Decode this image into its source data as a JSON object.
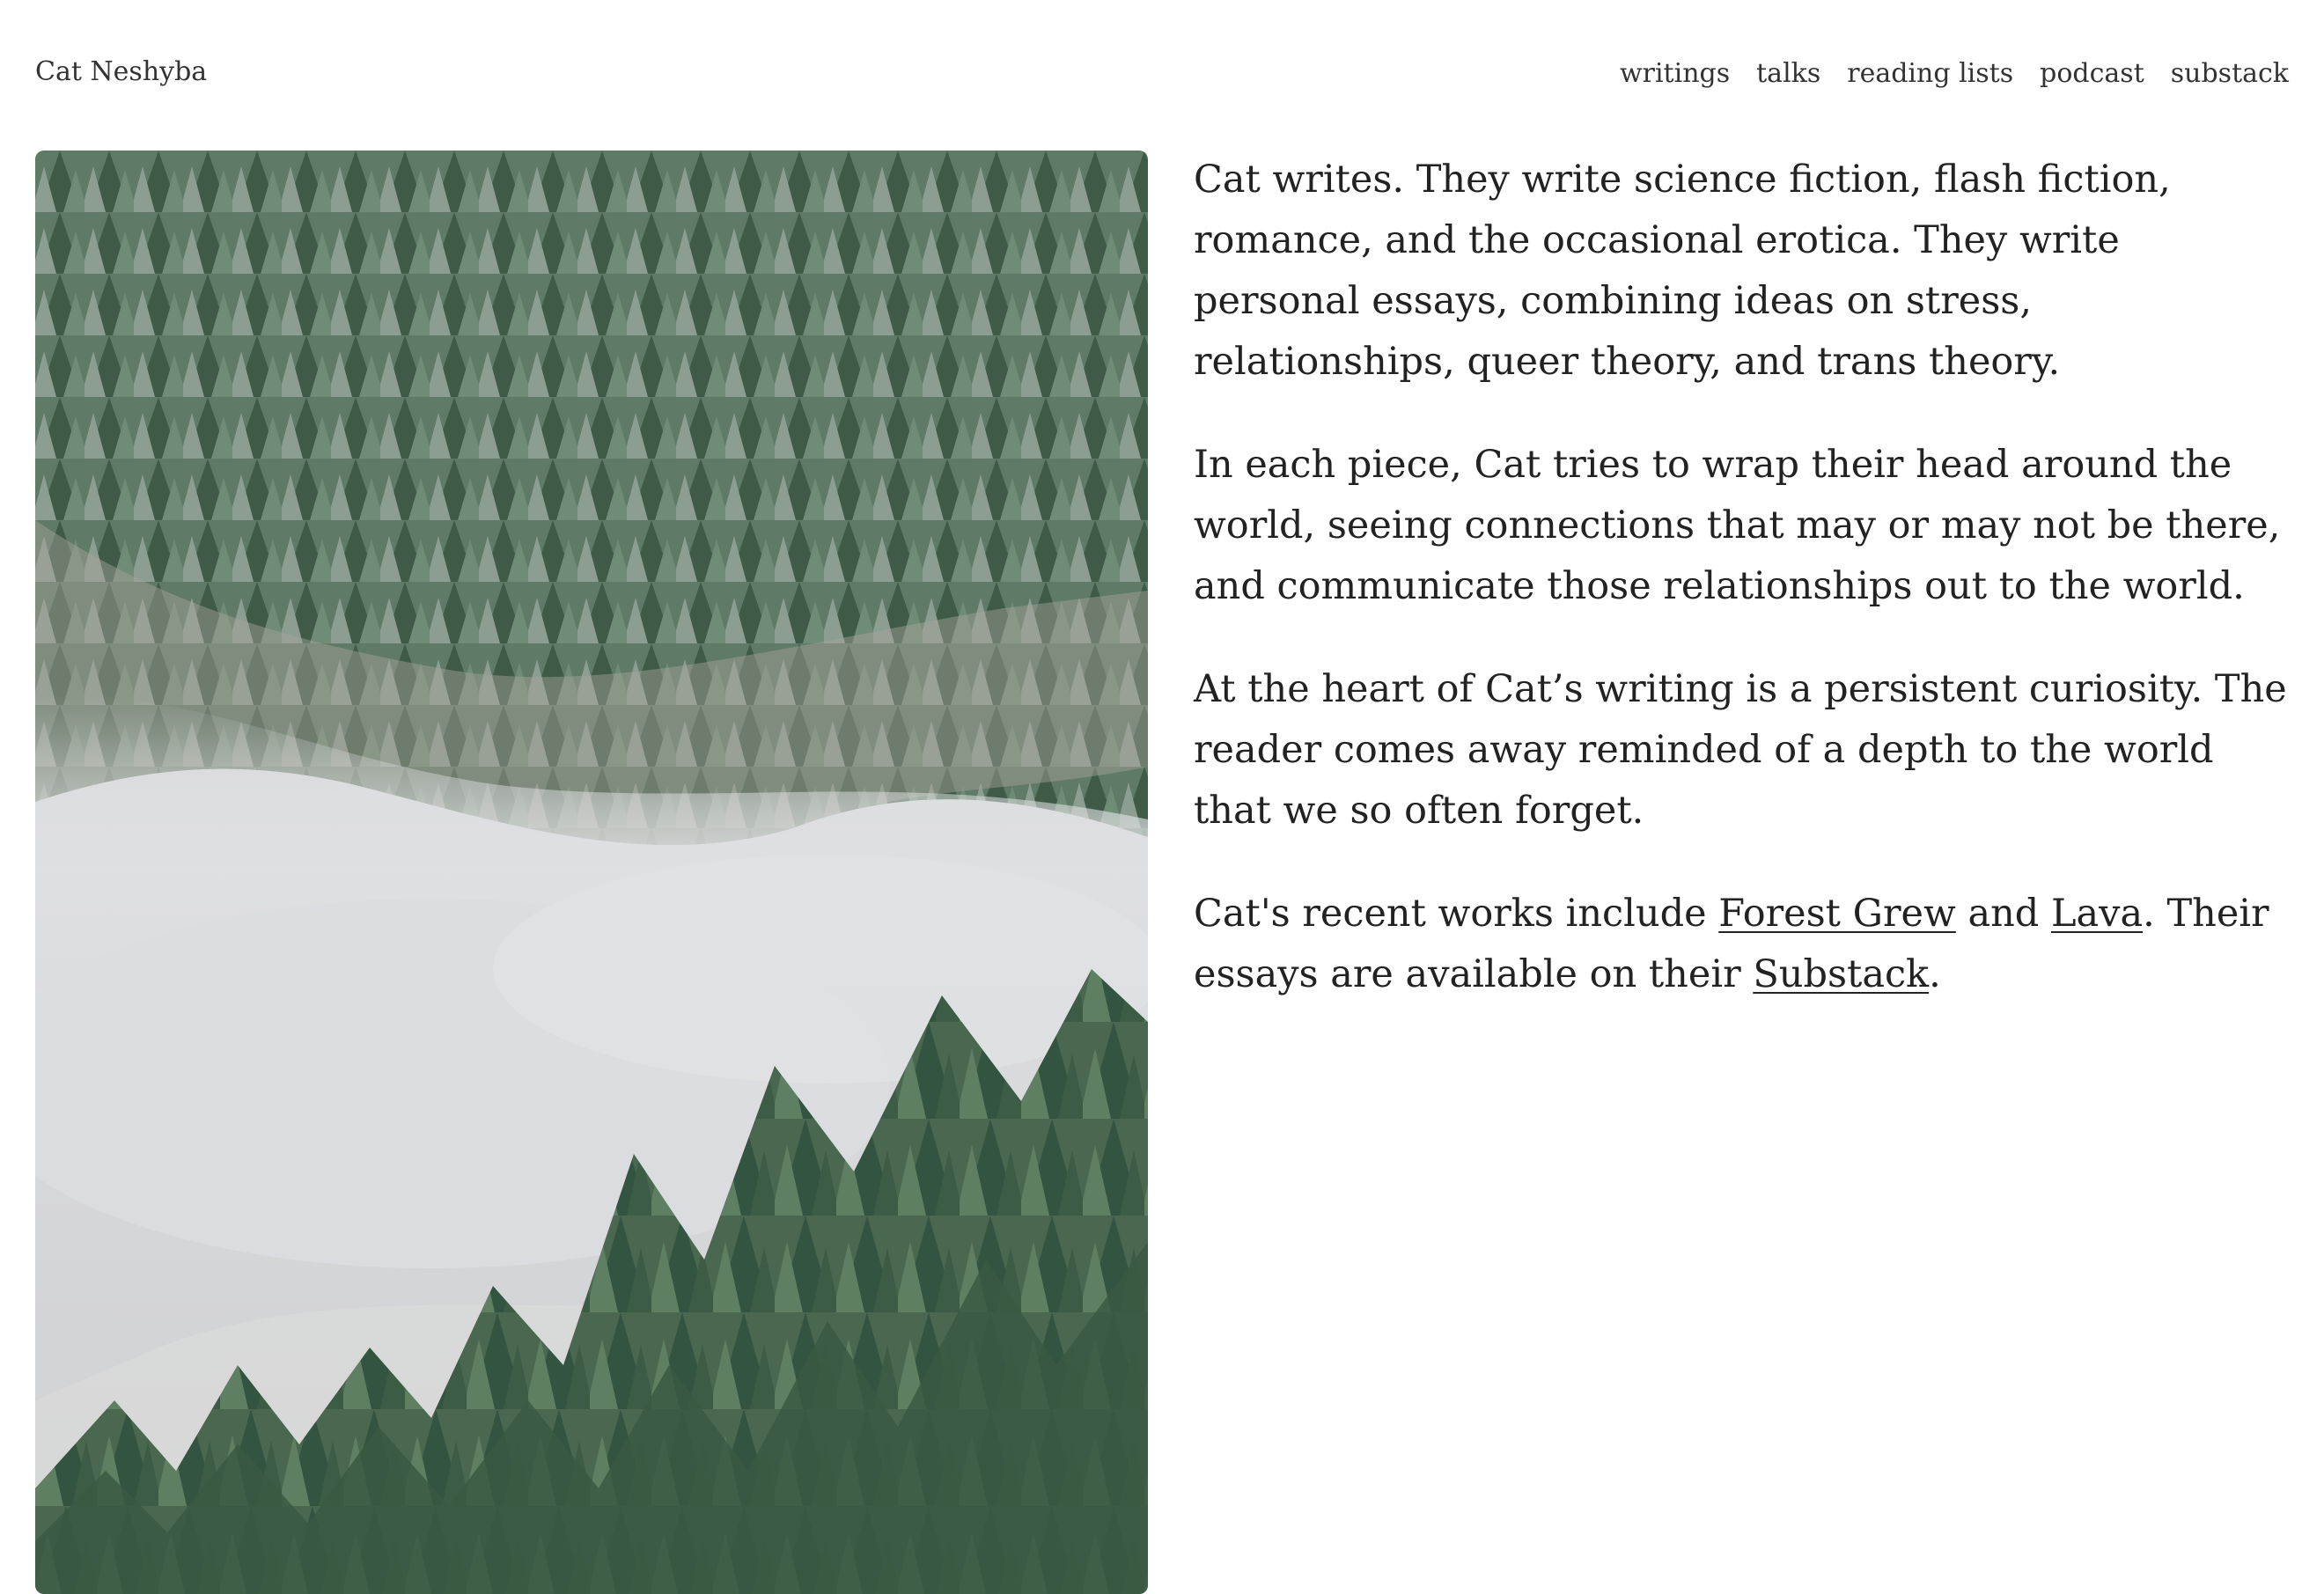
{
  "site": {
    "title": "Cat Neshyba"
  },
  "nav": {
    "items": [
      {
        "label": "writings"
      },
      {
        "label": "talks"
      },
      {
        "label": "reading lists"
      },
      {
        "label": "podcast"
      },
      {
        "label": "substack"
      }
    ]
  },
  "hero": {
    "icon": "foggy-forest-image"
  },
  "content": {
    "p1": "Cat writes. They write science fiction, flash fiction, romance, and the occasional erotica. They write personal essays, combining ideas on stress, relationships, queer theory, and trans theory.",
    "p2": "In each piece, Cat tries to wrap their head around the world, seeing connections that may or may not be there, and communicate those relationships out to the world.",
    "p3": "At the heart of Cat’s writing is a persistent curiosity. The reader comes away reminded of a depth to the world that we so often forget.",
    "p4": {
      "before": "Cat's recent works include ",
      "link1": "Forest Grew",
      "between1": " and ",
      "link2": "Lava",
      "between2": ". Their essays are available on their ",
      "link3": "Substack",
      "after": "."
    }
  },
  "colors": {
    "text": "#222222",
    "background": "#ffffff",
    "fog": "#d8d9da",
    "pine": "#4f6d55"
  }
}
